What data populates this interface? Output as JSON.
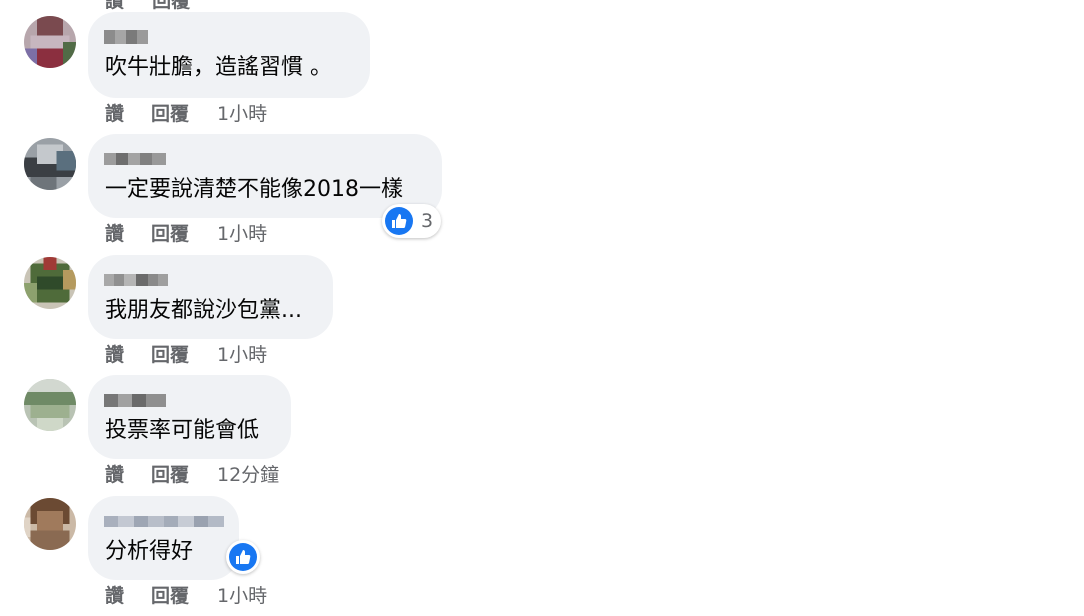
{
  "actions": {
    "like_label": "讚",
    "reply_label": "回覆"
  },
  "comments": [
    {
      "author": "",
      "text": "吹牛壯膽，造謠習慣 。",
      "time": "1小時",
      "reactions": null
    },
    {
      "author": "",
      "text": "一定要說清楚不能像2018一樣",
      "time": "1小時",
      "reactions": "3"
    },
    {
      "author": "",
      "text": "我朋友都說沙包黨...",
      "time": "1小時",
      "reactions": null
    },
    {
      "author": "",
      "text": "投票率可能會低",
      "time": "12分鐘",
      "reactions": null
    },
    {
      "author": "",
      "text": "分析得好",
      "time": "1小時",
      "reactions": ""
    }
  ],
  "colors": {
    "bubble_bg": "#f0f2f5",
    "meta_text": "#65676b",
    "like_blue": "#1877f2"
  }
}
